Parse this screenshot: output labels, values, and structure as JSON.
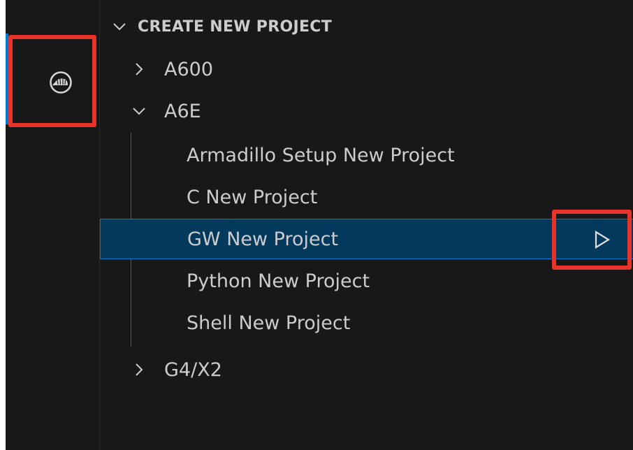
{
  "activity_bar": {
    "extension_icon": "armadillo-logo-icon"
  },
  "sidebar": {
    "section_title": "CREATE NEW PROJECT",
    "tree": [
      {
        "label": "A600",
        "expanded": false
      },
      {
        "label": "A6E",
        "expanded": true,
        "children": [
          {
            "label": "Armadillo Setup New Project"
          },
          {
            "label": "C New Project"
          },
          {
            "label": "GW New Project",
            "selected": true,
            "action_icon": "run-icon"
          },
          {
            "label": "Python New Project"
          },
          {
            "label": "Shell New Project"
          }
        ]
      },
      {
        "label": "G4/X2",
        "expanded": false
      }
    ]
  },
  "colors": {
    "background": "#181818",
    "text": "#cccccc",
    "selection": "#04395e",
    "focus_border": "#0078d4",
    "annotation": "#e8332a"
  }
}
